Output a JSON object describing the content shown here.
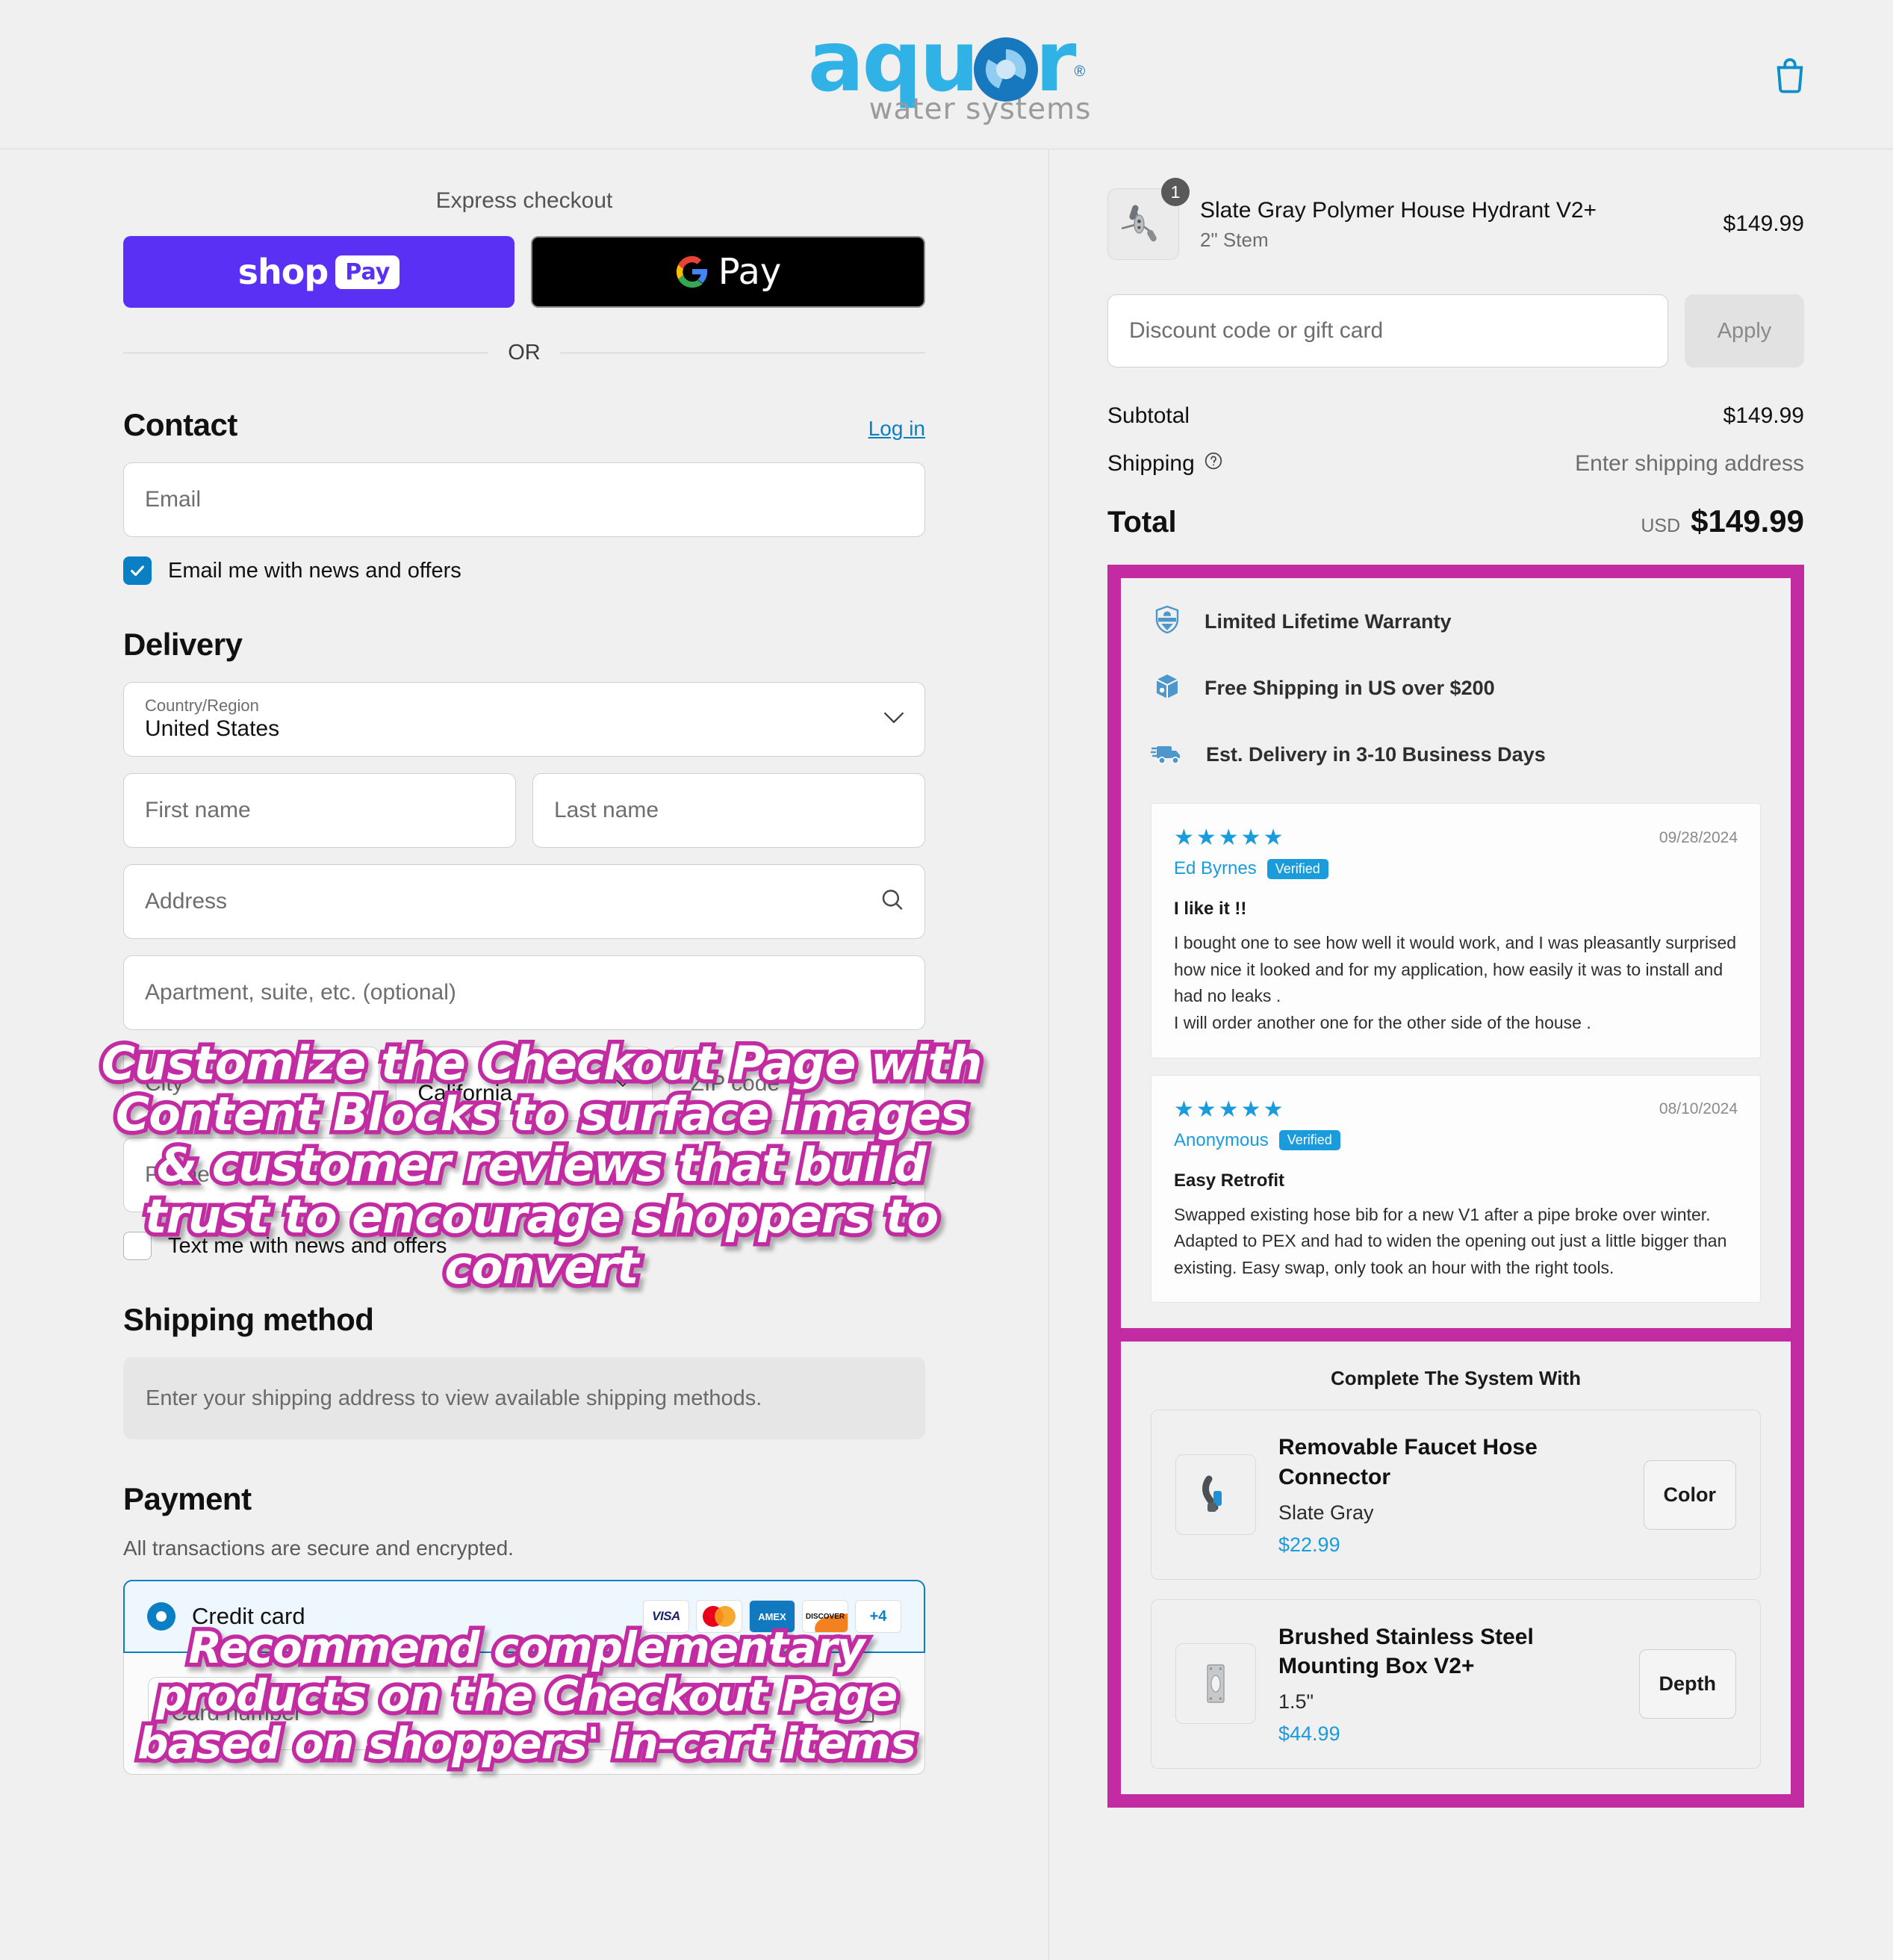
{
  "brand": {
    "name": "aquor",
    "tagline": "water systems",
    "registered_mark": "®",
    "logo_color": "#31b2e6",
    "logo_accent": "#1878be",
    "cart_icon": "shopping-bag-icon"
  },
  "express": {
    "label": "Express checkout",
    "shop_pay": {
      "word": "shop",
      "pill": "Pay",
      "color": "#5a31f4"
    },
    "google_pay": {
      "word": "Pay",
      "icon": "google-g-icon",
      "color": "#000000"
    },
    "divider": "OR"
  },
  "contact": {
    "title": "Contact",
    "login_label": "Log in",
    "email_placeholder": "Email",
    "email_value": "",
    "newsletter_label": "Email me with news and offers",
    "newsletter_checked": true
  },
  "delivery": {
    "title": "Delivery",
    "country": {
      "label": "Country/Region",
      "value": "United States"
    },
    "first_name_placeholder": "First name",
    "last_name_placeholder": "Last name",
    "address_placeholder": "Address",
    "address_icon": "search-icon",
    "apartment_placeholder": "Apartment, suite, etc. (optional)",
    "city_placeholder": "City",
    "state": {
      "label": "State",
      "value": "California"
    },
    "zip_placeholder": "ZIP code",
    "phone_placeholder": "Phone",
    "phone_icon": "help-circle-icon",
    "sms_label": "Text me with news and offers",
    "sms_checked": false
  },
  "shipping_method": {
    "title": "Shipping method",
    "placeholder": "Enter your shipping address to view available shipping methods."
  },
  "payment": {
    "title": "Payment",
    "note": "All transactions are secure and encrypted.",
    "option_label": "Credit card",
    "option_selected": true,
    "cards": [
      "VISA",
      "Mastercard",
      "AMEX",
      "DISCOVER",
      "+4"
    ],
    "card_number_placeholder": "Card number",
    "card_number_icon": "lock-icon",
    "accent_color": "#0b7fc4"
  },
  "summary": {
    "line_items": [
      {
        "title": "Slate Gray Polymer House Hydrant V2+",
        "variant": "2\" Stem",
        "price": "$149.99",
        "quantity": "1"
      }
    ],
    "discount_placeholder": "Discount code or gift card",
    "apply_label": "Apply",
    "subtotal_label": "Subtotal",
    "subtotal_value": "$149.99",
    "shipping_label": "Shipping",
    "shipping_icon": "help-circle-icon",
    "shipping_value": "Enter shipping address",
    "total_label": "Total",
    "total_currency": "USD",
    "total_value": "$149.99"
  },
  "trust_badges": [
    {
      "icon": "warranty-shield-icon",
      "text": "Limited Lifetime Warranty"
    },
    {
      "icon": "package-box-icon",
      "text": "Free Shipping in US over $200"
    },
    {
      "icon": "delivery-truck-icon",
      "text": "Est. Delivery in 3-10 Business Days"
    }
  ],
  "reviews": [
    {
      "stars": "★★★★★",
      "rating": 5,
      "date": "09/28/2024",
      "author": "Ed Byrnes",
      "verified_label": "Verified",
      "title": "I like it !!",
      "body": "I bought one to see how well it would work, and I was pleasantly surprised how nice it looked and for my application, how easily it was to install and had no leaks .\nI will order another one for the other side of the house ."
    },
    {
      "stars": "★★★★★",
      "rating": 5,
      "date": "08/10/2024",
      "author": "Anonymous",
      "verified_label": "Verified",
      "title": "Easy Retrofit",
      "body": "Swapped existing hose bib for a new V1 after a pipe broke over winter. Adapted to PEX and had to widen the opening out just a little bigger than existing. Easy swap, only took an hour with the right tools."
    }
  ],
  "upsell": {
    "title": "Complete The System With",
    "items": [
      {
        "name": "Removable Faucet Hose Connector",
        "variant": "Slate Gray",
        "price": "$22.99",
        "button": "Color"
      },
      {
        "name": "Brushed Stainless Steel Mounting Box V2+",
        "variant": "1.5\"",
        "price": "$44.99",
        "button": "Depth"
      }
    ]
  },
  "callouts": [
    {
      "text": "Customize the Checkout Page with Content Blocks to surface images & customer reviews that build trust to encourage shoppers to convert",
      "color": "#c32ba3"
    },
    {
      "text": "Recommend complementary products on the Checkout Page based on shoppers' in-cart items",
      "color": "#c32ba3"
    }
  ]
}
